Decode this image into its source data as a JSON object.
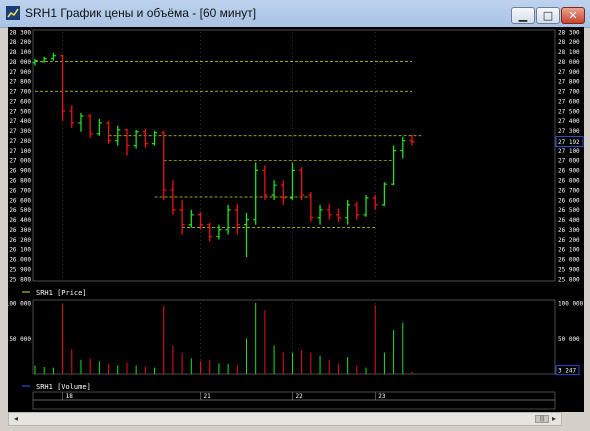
{
  "window": {
    "title": "SRH1 График цены и объёма - [60 минут]",
    "buttons": {
      "minimize": "▁",
      "maximize": "□",
      "close": "✕"
    }
  },
  "colors": {
    "up": "#20e020",
    "down": "#e81414",
    "axis": "#ffffff",
    "guide": "#d8d820",
    "vol_last": "#3a5cff",
    "background": "#000000"
  },
  "chart_data": [
    {
      "type": "candlestick",
      "name": "SRH1 [Price]",
      "ylim": [
        25800,
        28300
      ],
      "yticks": [
        "28 300",
        "28 200",
        "28 100",
        "28 000",
        "27 900",
        "27 800",
        "27 700",
        "27 600",
        "27 500",
        "27 400",
        "27 300",
        "27 200",
        "27 100",
        "27 000",
        "26 900",
        "26 800",
        "26 700",
        "26 600",
        "26 500",
        "26 400",
        "26 300",
        "26 200",
        "26 100",
        "26 000",
        "25 900",
        "25 800"
      ],
      "ytick_values": [
        28300,
        28200,
        28100,
        28000,
        27900,
        27800,
        27700,
        27600,
        27500,
        27400,
        27300,
        27200,
        27100,
        27000,
        26900,
        26800,
        26700,
        26600,
        26500,
        26400,
        26300,
        26200,
        26100,
        26000,
        25900,
        25800
      ],
      "last_price": "27 192",
      "date_labels": [
        "18",
        "21",
        "22",
        "23"
      ],
      "date_bar_index": [
        3,
        18,
        28,
        37
      ],
      "bars": [
        {
          "o": 27990,
          "h": 28030,
          "l": 27960,
          "c": 28010
        },
        {
          "o": 28000,
          "h": 28050,
          "l": 27990,
          "c": 28030
        },
        {
          "o": 28030,
          "h": 28090,
          "l": 28010,
          "c": 28060
        },
        {
          "o": 28060,
          "h": 28070,
          "l": 27400,
          "c": 27500
        },
        {
          "o": 27500,
          "h": 27560,
          "l": 27330,
          "c": 27380
        },
        {
          "o": 27380,
          "h": 27480,
          "l": 27290,
          "c": 27450
        },
        {
          "o": 27450,
          "h": 27470,
          "l": 27230,
          "c": 27270
        },
        {
          "o": 27270,
          "h": 27420,
          "l": 27250,
          "c": 27380
        },
        {
          "o": 27380,
          "h": 27400,
          "l": 27170,
          "c": 27200
        },
        {
          "o": 27200,
          "h": 27350,
          "l": 27150,
          "c": 27310
        },
        {
          "o": 27310,
          "h": 27320,
          "l": 27050,
          "c": 27150
        },
        {
          "o": 27150,
          "h": 27310,
          "l": 27120,
          "c": 27290
        },
        {
          "o": 27290,
          "h": 27320,
          "l": 27130,
          "c": 27170
        },
        {
          "o": 27170,
          "h": 27300,
          "l": 27150,
          "c": 27280
        },
        {
          "o": 27280,
          "h": 27300,
          "l": 26600,
          "c": 26700
        },
        {
          "o": 26700,
          "h": 26800,
          "l": 26450,
          "c": 26500
        },
        {
          "o": 26500,
          "h": 26600,
          "l": 26250,
          "c": 26350
        },
        {
          "o": 26350,
          "h": 26500,
          "l": 26320,
          "c": 26450
        },
        {
          "o": 26450,
          "h": 26480,
          "l": 26300,
          "c": 26350
        },
        {
          "o": 26350,
          "h": 26370,
          "l": 26180,
          "c": 26230
        },
        {
          "o": 26230,
          "h": 26350,
          "l": 26200,
          "c": 26300
        },
        {
          "o": 26300,
          "h": 26550,
          "l": 26250,
          "c": 26500
        },
        {
          "o": 26500,
          "h": 26560,
          "l": 26250,
          "c": 26350
        },
        {
          "o": 26350,
          "h": 26470,
          "l": 26020,
          "c": 26400
        },
        {
          "o": 26400,
          "h": 26980,
          "l": 26350,
          "c": 26900
        },
        {
          "o": 26900,
          "h": 26950,
          "l": 26600,
          "c": 26650
        },
        {
          "o": 26650,
          "h": 26800,
          "l": 26600,
          "c": 26750
        },
        {
          "o": 26750,
          "h": 26800,
          "l": 26550,
          "c": 26620
        },
        {
          "o": 26620,
          "h": 26980,
          "l": 26600,
          "c": 26900
        },
        {
          "o": 26900,
          "h": 26930,
          "l": 26600,
          "c": 26650
        },
        {
          "o": 26650,
          "h": 26680,
          "l": 26380,
          "c": 26420
        },
        {
          "o": 26420,
          "h": 26550,
          "l": 26350,
          "c": 26500
        },
        {
          "o": 26500,
          "h": 26560,
          "l": 26400,
          "c": 26450
        },
        {
          "o": 26450,
          "h": 26510,
          "l": 26380,
          "c": 26420
        },
        {
          "o": 26420,
          "h": 26600,
          "l": 26350,
          "c": 26550
        },
        {
          "o": 26550,
          "h": 26580,
          "l": 26400,
          "c": 26450
        },
        {
          "o": 26450,
          "h": 26650,
          "l": 26430,
          "c": 26620
        },
        {
          "o": 26620,
          "h": 26650,
          "l": 26500,
          "c": 26550
        },
        {
          "o": 26550,
          "h": 26780,
          "l": 26540,
          "c": 26760
        },
        {
          "o": 26760,
          "h": 27150,
          "l": 26750,
          "c": 27100
        },
        {
          "o": 27100,
          "h": 27240,
          "l": 27020,
          "c": 27200
        },
        {
          "o": 27200,
          "h": 27260,
          "l": 27150,
          "c": 27190
        }
      ],
      "guide_levels": [
        {
          "price": 28000,
          "from_bar": 0,
          "to_bar": 41
        },
        {
          "price": 27700,
          "from_bar": 0,
          "to_bar": 41
        },
        {
          "price": 27250,
          "from_bar": 8,
          "to_bar": 42
        },
        {
          "price": 27000,
          "from_bar": 14,
          "to_bar": 39
        },
        {
          "price": 26630,
          "from_bar": 13,
          "to_bar": 30
        },
        {
          "price": 26320,
          "from_bar": 16,
          "to_bar": 37
        }
      ]
    },
    {
      "type": "bar",
      "name": "SRH1 [Volume]",
      "ylim": [
        0,
        100000
      ],
      "yticks": [
        "100 000",
        "50 000"
      ],
      "ytick_values": [
        100000,
        50000
      ],
      "last_value": "3 247",
      "values": [
        12000,
        10000,
        9000,
        98000,
        35000,
        20000,
        22000,
        18000,
        14000,
        12000,
        16000,
        12000,
        10000,
        9000,
        96000,
        40000,
        30000,
        22000,
        18000,
        20000,
        15000,
        14000,
        12000,
        50000,
        100000,
        90000,
        40000,
        30000,
        30000,
        34000,
        30000,
        26000,
        20000,
        14000,
        24000,
        12000,
        9000,
        97000,
        30000,
        62000,
        72000,
        3247
      ]
    }
  ],
  "legend": {
    "price_series": "SRH1 [Price]",
    "volume_series": "SRH1 [Volume]"
  }
}
